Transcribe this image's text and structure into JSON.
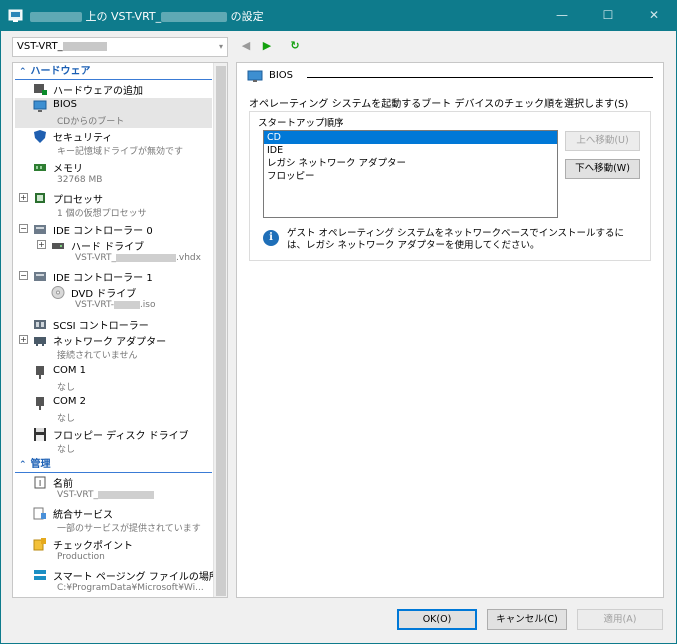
{
  "window": {
    "title_suffix": "上の VST-VRT_",
    "title_end": "の設定",
    "minimize": "—",
    "maximize": "☐",
    "close": "✕"
  },
  "vm_selector": {
    "value": "VST-VRT_"
  },
  "nav": {
    "back": "◀",
    "forward": "▶",
    "refresh": "↻"
  },
  "sections": {
    "hardware": "ハードウェア",
    "management": "管理"
  },
  "hardware_items": [
    {
      "label": "ハードウェアの追加",
      "sub": ""
    },
    {
      "label": "BIOS",
      "sub": "CDからのブート"
    },
    {
      "label": "セキュリティ",
      "sub": "キー記憶域ドライブが無効です"
    },
    {
      "label": "メモリ",
      "sub": "32768 MB"
    },
    {
      "label": "プロセッサ",
      "sub": "1 個の仮想プロセッサ"
    },
    {
      "label": "IDE コントローラー 0",
      "sub": ""
    },
    {
      "label": "ハード ドライブ",
      "sub_prefix": "VST-VRT_",
      "sub_suffix": ".vhdx"
    },
    {
      "label": "IDE コントローラー 1",
      "sub": ""
    },
    {
      "label": "DVD ドライブ",
      "sub_prefix": "VST-VRT-",
      "sub_suffix": ".iso"
    },
    {
      "label": "SCSI コントローラー",
      "sub": ""
    },
    {
      "label": "ネットワーク アダプター",
      "sub": "接続されていません"
    },
    {
      "label": "COM 1",
      "sub": "なし"
    },
    {
      "label": "COM 2",
      "sub": "なし"
    },
    {
      "label": "フロッピー ディスク ドライブ",
      "sub": "なし"
    }
  ],
  "management_items": [
    {
      "label": "名前",
      "sub": "VST-VRT_"
    },
    {
      "label": "統合サービス",
      "sub": "一部のサービスが提供されています"
    },
    {
      "label": "チェックポイント",
      "sub": "Production"
    },
    {
      "label": "スマート ページング ファイルの場所",
      "sub": "C:¥ProgramData¥Microsoft¥Wi..."
    }
  ],
  "bios": {
    "heading": "BIOS",
    "description": "オペレーティング システムを起動するブート デバイスのチェック順を選択します(S)",
    "group_title": "スタートアップ順序",
    "startup_order": [
      "CD",
      "IDE",
      "レガシ ネットワーク アダプター",
      "フロッピー"
    ],
    "selected": "CD",
    "move_up": "上へ移動(U)",
    "move_down": "下へ移動(W)",
    "info": "ゲスト オペレーティング システムをネットワークベースでインストールするには、レガシ ネットワーク アダプターを使用してください。"
  },
  "buttons": {
    "ok": "OK(O)",
    "cancel": "キャンセル(C)",
    "apply": "適用(A)"
  },
  "colors": {
    "titlebar": "#0e7b8c",
    "accent": "#1b5fb4",
    "selection": "#0078d7"
  }
}
